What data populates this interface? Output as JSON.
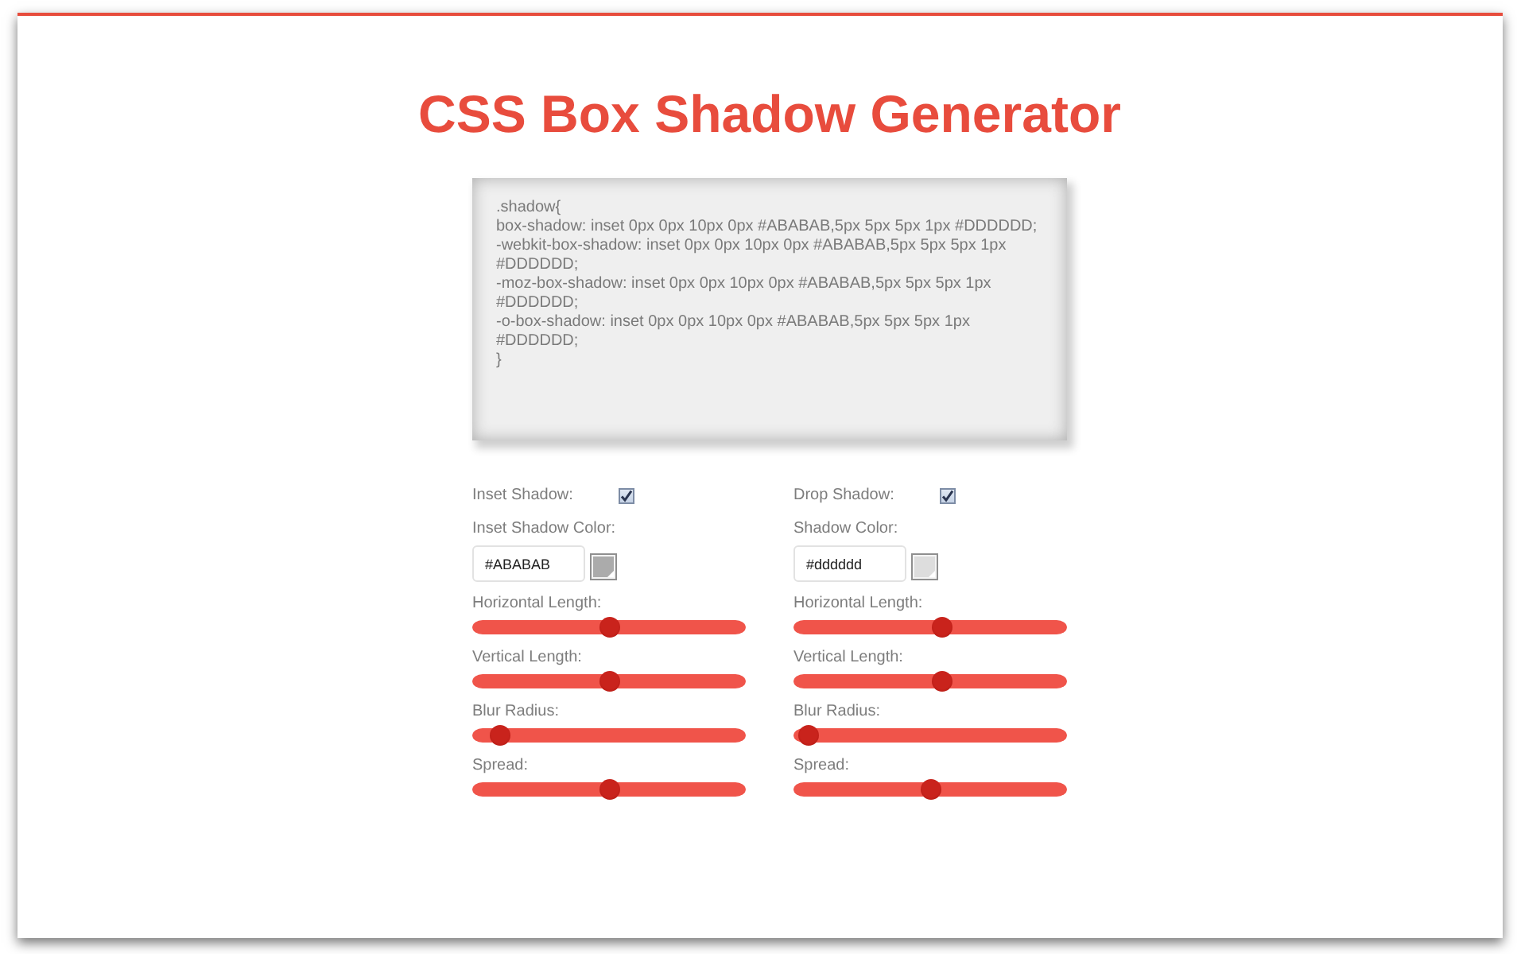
{
  "title": "CSS Box Shadow Generator",
  "code": {
    "lines": [
      ".shadow{",
      "box-shadow: inset 0px 0px 10px 0px #ABABAB,5px 5px 5px 1px #DDDDDD;",
      "-webkit-box-shadow: inset 0px 0px 10px 0px #ABABAB,5px 5px 5px 1px",
      "#DDDDDD;",
      "-moz-box-shadow: inset 0px 0px 10px 0px #ABABAB,5px 5px 5px 1px",
      "#DDDDDD;",
      "-o-box-shadow: inset 0px 0px 10px 0px #ABABAB,5px 5px 5px 1px",
      "#DDDDDD;",
      "}"
    ]
  },
  "panels": [
    {
      "toggle_label": "Inset Shadow:",
      "checked": true,
      "color_label": "Inset Shadow Color:",
      "color_value": "#ABABAB",
      "color": "#ababab",
      "sliders": [
        {
          "label": "Horizontal Length:",
          "level": 0.5
        },
        {
          "label": "Vertical Length:",
          "level": 0.5
        },
        {
          "label": "Blur Radius:",
          "level": 0.07
        },
        {
          "label": "Spread:",
          "level": 0.5
        }
      ]
    },
    {
      "toggle_label": "Drop Shadow:",
      "checked": true,
      "color_label": "Shadow Color:",
      "color_value": "#dddddd",
      "color": "#dddddd",
      "sliders": [
        {
          "label": "Horizontal Length:",
          "level": 0.55
        },
        {
          "label": "Vertical Length:",
          "level": 0.55
        },
        {
          "label": "Blur Radius:",
          "level": 0.02
        },
        {
          "label": "Spread:",
          "level": 0.5
        }
      ]
    }
  ]
}
